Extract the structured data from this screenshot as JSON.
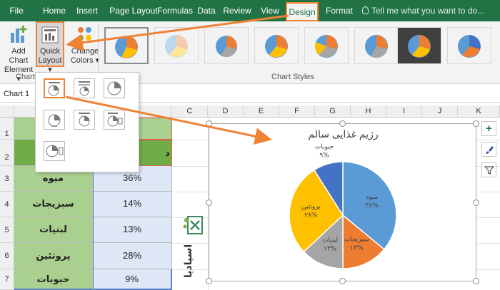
{
  "ribbon_tabs": [
    "File",
    "Home",
    "Insert",
    "Page Layout",
    "Formulas",
    "Data",
    "Review",
    "View",
    "Design",
    "Format"
  ],
  "active_tab": "Design",
  "tell_me_placeholder": "Tell me what you want to do...",
  "ribbon": {
    "add_chart_element": [
      "Add Chart",
      "Element ▾"
    ],
    "quick_layout": [
      "Quick",
      "Layout ▾"
    ],
    "change_colors": [
      "Change",
      "Colors ▾"
    ],
    "group_chart_layouts": "Chart La",
    "group_chart_styles": "Chart Styles"
  },
  "name_box": "Chart 1",
  "columns": [
    "C",
    "D",
    "E",
    "F",
    "G",
    "H",
    "I",
    "J",
    "K"
  ],
  "rows": [
    "1",
    "2",
    "3",
    "4",
    "5",
    "6",
    "7"
  ],
  "table": {
    "header_value": "د",
    "rows": [
      {
        "label": "میوه",
        "value": "36%"
      },
      {
        "label": "سبزیجات",
        "value": "14%"
      },
      {
        "label": "لبنیات",
        "value": "13%"
      },
      {
        "label": "پروتئین",
        "value": "28%"
      },
      {
        "label": "حبوبات",
        "value": "9%"
      }
    ]
  },
  "logo_text": "اسپادیا",
  "colors": {
    "ribbon": "#217346",
    "highlight": "#f08234",
    "label_col": "#a9d08e",
    "value_col": "#dde7f6"
  },
  "chart_data": {
    "type": "pie",
    "title": "رژیم غذایی سالم",
    "categories": [
      "میوه",
      "سبزیجات",
      "لبنیات",
      "پروتئین",
      "حبوبات"
    ],
    "values": [
      36,
      14,
      13,
      28,
      9
    ],
    "labels": [
      "۳۶%",
      "۱۴%",
      "۱۳%",
      "۲۸%",
      "۹%"
    ],
    "colors": [
      "#5b9bd5",
      "#ed7d31",
      "#a5a5a5",
      "#ffc000",
      "#4472c4"
    ]
  }
}
